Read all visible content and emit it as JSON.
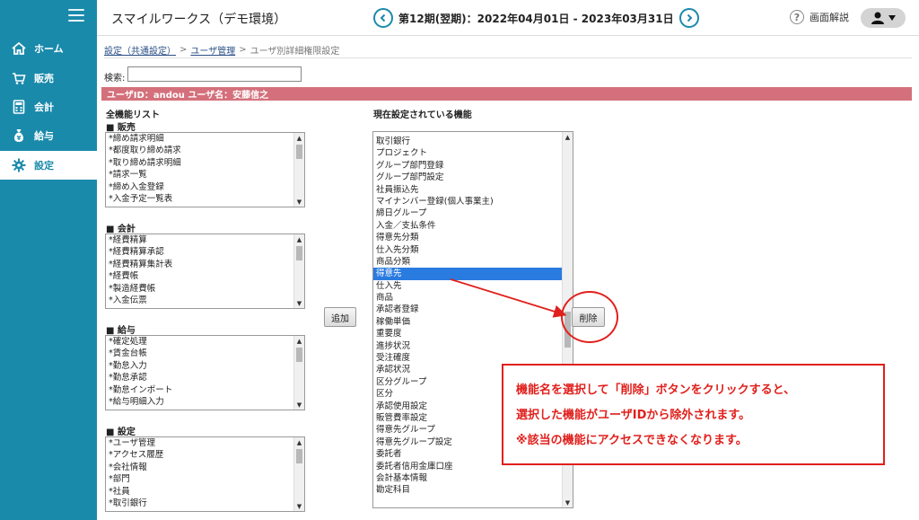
{
  "sidebar": {
    "items": [
      {
        "label": "ホーム",
        "icon": "home-icon"
      },
      {
        "label": "販売",
        "icon": "cart-icon"
      },
      {
        "label": "会計",
        "icon": "calculator-icon"
      },
      {
        "label": "給与",
        "icon": "money-bag-icon"
      },
      {
        "label": "設定",
        "icon": "gear-icon"
      }
    ],
    "active_index": 4
  },
  "header": {
    "app_title": "スマイルワークス（デモ環境）",
    "period": "第12期(翌期)：2022年04月01日 - 2023年03月31日",
    "help_label": "画面解説"
  },
  "breadcrumb": {
    "link1": "設定（共通設定）",
    "link2": "ユーザ管理",
    "current": "ユーザ別詳細権限設定",
    "sep": ">"
  },
  "search": {
    "label": "検索:",
    "value": ""
  },
  "user_banner": "ユーザID：andou  ユーザ名：安藤信之",
  "all_functions": {
    "title": "全機能リスト",
    "categories": [
      {
        "label": "■ 販売",
        "items": [
          "*締め請求明細",
          "*都度取り締め請求",
          "*取り締め請求明細",
          "*請求一覧",
          "*締め入金登録",
          "*入金予定一覧表"
        ]
      },
      {
        "label": "■ 会計",
        "items": [
          "*経費精算",
          "*経費精算承認",
          "*経費精算集計表",
          "*経費帳",
          "*製造経費帳",
          "*入金伝票"
        ]
      },
      {
        "label": "■ 給与",
        "items": [
          "*確定処理",
          "*賃金台帳",
          "*勤怠入力",
          "*勤怠承認",
          "*勤怠インポート",
          "*給与明細入力"
        ]
      },
      {
        "label": "■ 設定",
        "items": [
          "*ユーザ管理",
          "*アクセス履歴",
          "*会社情報",
          "*部門",
          "*社員",
          "*取引銀行"
        ]
      }
    ]
  },
  "current_functions": {
    "title": "現在設定されている機能",
    "items": [
      "取引銀行",
      "プロジェクト",
      "グループ部門登録",
      "グループ部門設定",
      "社員振込先",
      "マイナンバー登録(個人事業主)",
      "締日グループ",
      "入金／支払条件",
      "得意先分類",
      "仕入先分類",
      "商品分類",
      "得意先",
      "仕入先",
      "商品",
      "承認者登録",
      "稼働単価",
      "重要度",
      "進捗状況",
      "受注確度",
      "承認状況",
      "区分グループ",
      "区分",
      "承認使用設定",
      "販管費率設定",
      "得意先グループ",
      "得意先グループ設定",
      "委託者",
      "委託者信用金庫口座",
      "会計基本情報",
      "勘定科目"
    ],
    "selected_index": 11
  },
  "buttons": {
    "add": "追加",
    "delete": "削除"
  },
  "annotation": {
    "lines": [
      "機能名を選択して「削除」ボタンをクリックすると、",
      "選択した機能がユーザIDから除外されます。",
      "※該当の機能にアクセスできなくなります。"
    ]
  },
  "colors": {
    "sidebar": "#1a8aab",
    "banner": "#d4707b",
    "annotation": "#e0201c",
    "selected": "#2a7be0"
  }
}
